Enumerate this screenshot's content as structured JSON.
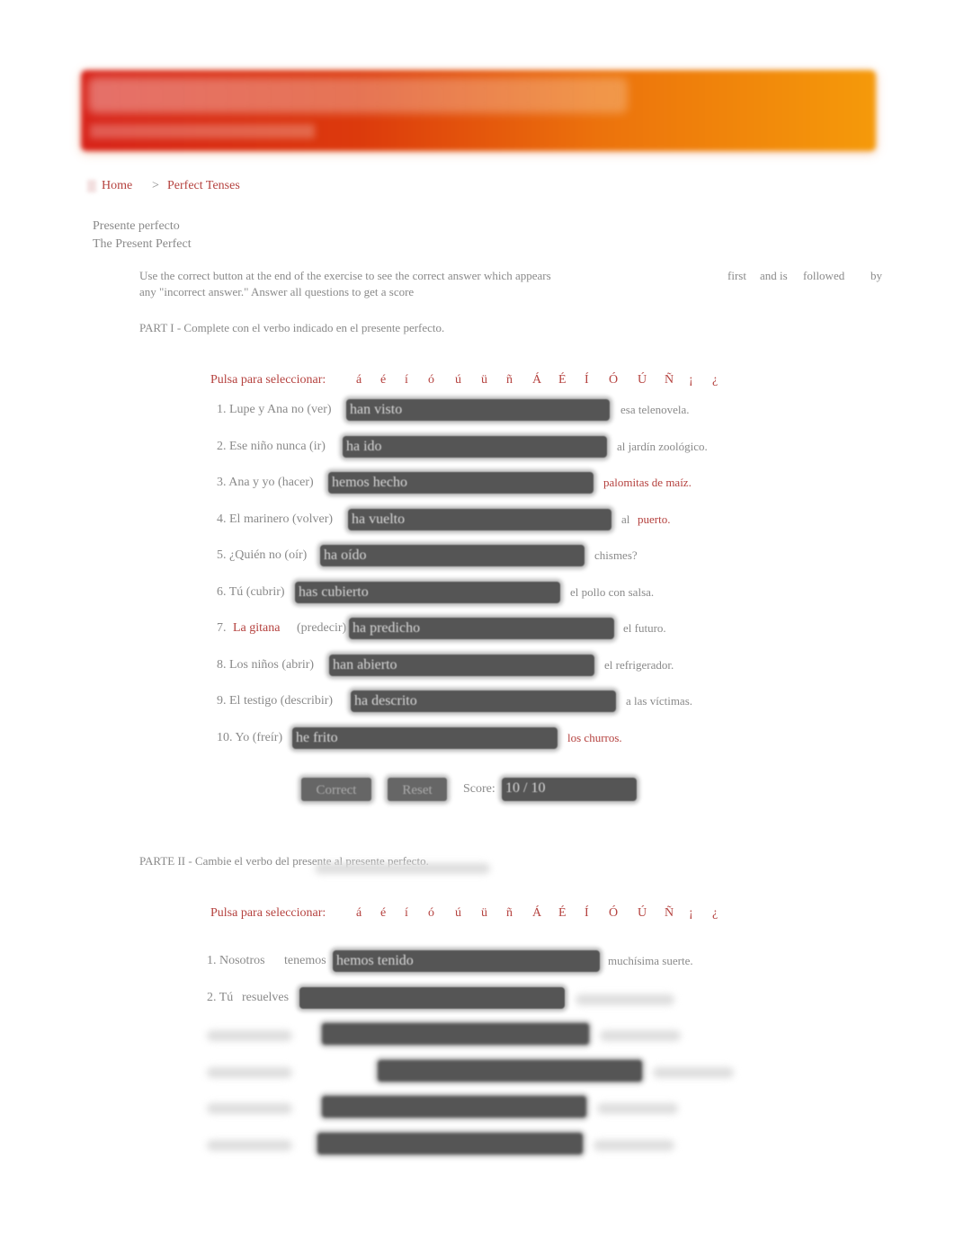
{
  "breadcrumb": {
    "home": "Home",
    "separator": ">",
    "current": "Perfect Tenses"
  },
  "heading": {
    "spanish": "Presente perfecto",
    "english": "The Present Perfect"
  },
  "instructions": {
    "line1": "Use the correct button at the end of the exercise to see the correct answer which appears",
    "line1_tail": [
      "first",
      "and is",
      "followed",
      "by"
    ],
    "line2": "any \"incorrect answer.\" Answer all questions to get a score"
  },
  "part1": {
    "title": "PART I - Complete con el verbo indicado en el presente perfecto.",
    "accent_label": "Pulsa para seleccionar:",
    "accents": [
      "á",
      "é",
      "í",
      "ó",
      "ú",
      "ü",
      "ñ",
      "Á",
      "É",
      "Í",
      "Ó",
      "Ú",
      "Ñ",
      "¡",
      "¿"
    ],
    "rows": [
      {
        "label": "1. Lupe y Ana no (ver)",
        "answer": "han visto",
        "after": "esa telenovela."
      },
      {
        "label": "2. Ese niño nunca (ir)",
        "answer": "ha ido",
        "after": "al jardín zoológico."
      },
      {
        "label": "3. Ana y yo (hacer)",
        "answer": "hemos hecho",
        "after_red": "palomitas de maíz."
      },
      {
        "label": "4. El marinero (volver)",
        "answer": "ha vuelto",
        "after": "al",
        "after_red": "puerto."
      },
      {
        "label": "5. ¿Quién no (oír)",
        "answer": "ha oído",
        "after": "chismes?"
      },
      {
        "label": "6. Tú (cubrir)",
        "answer": "has cubierto",
        "after": "el pollo con salsa."
      },
      {
        "label": "7.",
        "label_red": "La gitana",
        "label2": "(predecir)",
        "answer": "ha predicho",
        "after": "el futuro."
      },
      {
        "label": "8. Los niños (abrir)",
        "answer": "han abierto",
        "after": "el refrigerador."
      },
      {
        "label": "9. El testigo (describir)",
        "answer": "ha descrito",
        "after": "a las víctimas."
      },
      {
        "label": "10. Yo (freír)",
        "answer": "he frito",
        "after_red": "los churros."
      }
    ],
    "correct_label": "Correct",
    "reset_label": "Reset",
    "score_label": "Score:",
    "score_value": "10 / 10"
  },
  "part2": {
    "title": "PARTE II - Cambie el verbo del presente al presente perfecto.",
    "accent_label": "Pulsa para seleccionar:",
    "rows": [
      {
        "label": "1. Nosotros",
        "verb": "tenemos",
        "answer": "hemos tenido",
        "after": "muchísima suerte."
      },
      {
        "label": "2. Tú",
        "verb": "resuelves",
        "answer": ""
      }
    ]
  },
  "colors": {
    "accent": "#b5423f",
    "banner_start": "#d8231a",
    "banner_end": "#f59a0a"
  }
}
